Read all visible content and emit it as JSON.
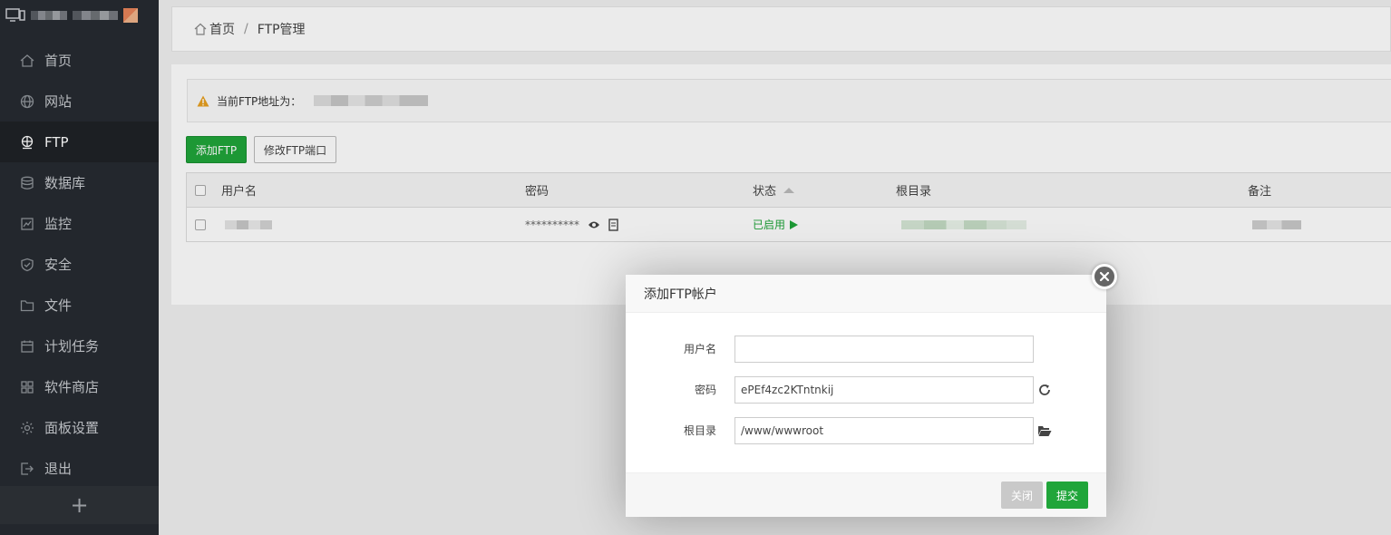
{
  "sidebar": {
    "items": [
      {
        "label": "首页",
        "icon": "home-icon",
        "active": false
      },
      {
        "label": "网站",
        "icon": "globe-icon",
        "active": false
      },
      {
        "label": "FTP",
        "icon": "ftp-icon",
        "active": true
      },
      {
        "label": "数据库",
        "icon": "database-icon",
        "active": false
      },
      {
        "label": "监控",
        "icon": "monitor-icon",
        "active": false
      },
      {
        "label": "安全",
        "icon": "shield-icon",
        "active": false
      },
      {
        "label": "文件",
        "icon": "folder-icon",
        "active": false
      },
      {
        "label": "计划任务",
        "icon": "calendar-icon",
        "active": false
      },
      {
        "label": "软件商店",
        "icon": "grid-icon",
        "active": false
      },
      {
        "label": "面板设置",
        "icon": "gear-icon",
        "active": false
      },
      {
        "label": "退出",
        "icon": "logout-icon",
        "active": false
      }
    ],
    "add_label": "+"
  },
  "breadcrumb": {
    "home": "首页",
    "separator": "/",
    "current": "FTP管理"
  },
  "notice": {
    "text": "当前FTP地址为："
  },
  "toolbar": {
    "add_ftp": "添加FTP",
    "change_port": "修改FTP端口"
  },
  "table": {
    "headers": {
      "username": "用户名",
      "password": "密码",
      "status": "状态",
      "root": "根目录",
      "note": "备注"
    },
    "rows": [
      {
        "password": "**********",
        "status": "已启用"
      }
    ]
  },
  "modal": {
    "title": "添加FTP帐户",
    "fields": {
      "username": {
        "label": "用户名",
        "value": ""
      },
      "password": {
        "label": "密码",
        "value": "ePEf4zc2KTntnkij"
      },
      "root": {
        "label": "根目录",
        "value": "/www/wwwroot"
      }
    },
    "buttons": {
      "close": "关闭",
      "submit": "提交"
    }
  },
  "colors": {
    "accent": "#20a53a",
    "sidebar": "#272b31",
    "disabled": "#c9c9c9"
  }
}
